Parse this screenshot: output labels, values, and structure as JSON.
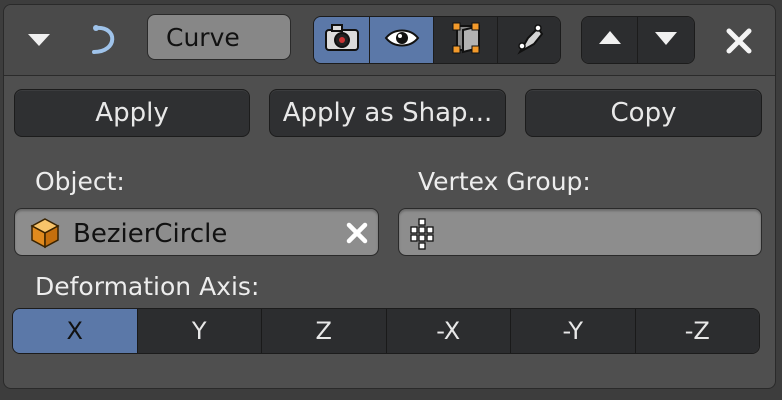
{
  "header": {
    "modifier_name": "Curve",
    "icons": [
      "chevron-down-icon",
      "curve-modifier-icon",
      "camera-render-icon",
      "eye-viewport-icon",
      "edit-mode-cage-icon",
      "on-cage-icon",
      "move-up-icon",
      "move-down-icon",
      "close-icon"
    ],
    "active_toggle": "eye-viewport-icon",
    "toggle_active_color": "#5b78a8"
  },
  "actions": {
    "apply": "Apply",
    "apply_as_shape": "Apply as Shap...",
    "copy": "Copy"
  },
  "object": {
    "label": "Object:",
    "value": "BezierCircle",
    "icon": "object-cube-icon"
  },
  "vertex_group": {
    "label": "Vertex Group:",
    "value": "",
    "icon": "vertex-group-icon"
  },
  "deformation_axis": {
    "label": "Deformation Axis:",
    "options": [
      "X",
      "Y",
      "Z",
      "-X",
      "-Y",
      "-Z"
    ],
    "selected": "X"
  }
}
